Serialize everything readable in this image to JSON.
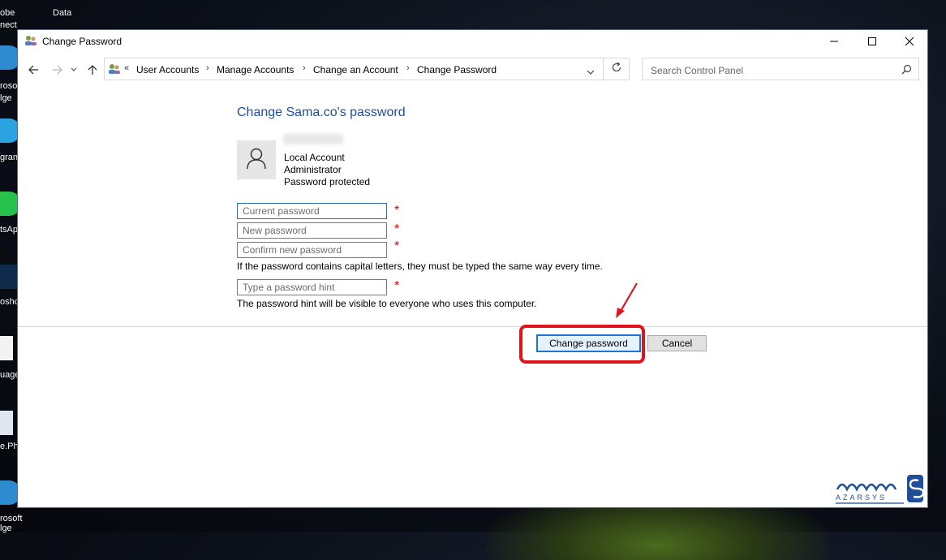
{
  "desktop": {
    "labels": [
      "obe",
      "nect",
      "Data",
      "rosof",
      "lge",
      "gran",
      "tsAp",
      "osho",
      "uage",
      "e.Ph",
      "rosoft",
      "lge"
    ]
  },
  "window": {
    "title": "Change Password",
    "controls": {
      "minimize": "—",
      "maximize": "□",
      "close": "✕"
    }
  },
  "address": {
    "overflow": "«",
    "breadcrumbs": [
      "User Accounts",
      "Manage Accounts",
      "Change an Account",
      "Change Password"
    ],
    "separator": "›"
  },
  "search": {
    "placeholder": "Search Control Panel"
  },
  "content": {
    "title": "Change Sama.co's password",
    "account_lines": [
      "Local Account",
      "Administrator",
      "Password protected"
    ],
    "fields": {
      "current": "Current password",
      "new": "New password",
      "confirm": "Confirm new password",
      "hint": "Type a password hint"
    },
    "required_mark": "*",
    "caps_note": "If the password contains capital letters, they must be typed the same way every time.",
    "hint_note": "The password hint will be visible to everyone who uses this computer."
  },
  "buttons": {
    "change": "Change password",
    "cancel": "Cancel"
  },
  "logo": {
    "brand": "AZARSYS",
    "accent": "#1f4f9a"
  },
  "colors": {
    "link_title": "#1e4e9c",
    "required": "#e00000",
    "highlight": "#e0141a"
  }
}
